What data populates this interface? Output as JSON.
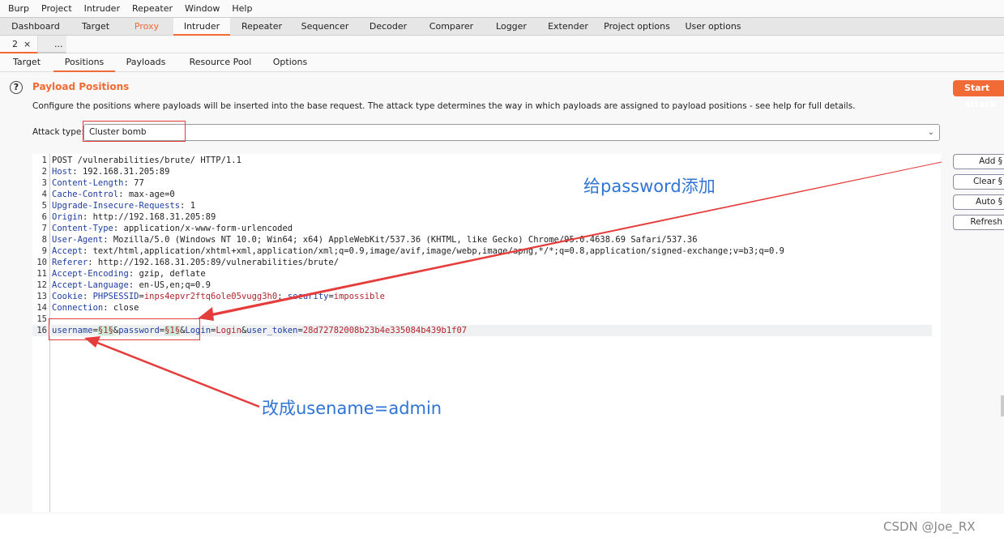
{
  "menu": [
    "Burp",
    "Project",
    "Intruder",
    "Repeater",
    "Window",
    "Help"
  ],
  "main_tabs": [
    "Dashboard",
    "Target",
    "Proxy",
    "Intruder",
    "Repeater",
    "Sequencer",
    "Decoder",
    "Comparer",
    "Logger",
    "Extender",
    "Project options",
    "User options"
  ],
  "intruder_tabs": {
    "tab": "2",
    "close": "×",
    "more": "..."
  },
  "sub_tabs": [
    "Target",
    "Positions",
    "Payloads",
    "Resource Pool",
    "Options"
  ],
  "positions": {
    "help": "?",
    "title": "Payload Positions",
    "description": "Configure the positions where payloads will be inserted into the base request. The attack type determines the way in which payloads are assigned to payload positions - see help for full details.",
    "attack_type_label": "Attack type:",
    "attack_type": "Cluster bomb",
    "start_attack": "Start attack",
    "buttons": [
      "Add §",
      "Clear §",
      "Auto §",
      "Refresh"
    ]
  },
  "request": [
    {
      "n": "1",
      "parts": [
        [
          "",
          "POST /vulnerabilities/brute/ HTTP/1.1"
        ]
      ]
    },
    {
      "n": "2",
      "parts": [
        [
          "hn",
          "Host"
        ],
        [
          "",
          ": 192.168.31.205:89"
        ]
      ]
    },
    {
      "n": "3",
      "parts": [
        [
          "hn",
          "Content-Length"
        ],
        [
          "",
          ": 77"
        ]
      ]
    },
    {
      "n": "4",
      "parts": [
        [
          "hn",
          "Cache-Control"
        ],
        [
          "",
          ": max-age=0"
        ]
      ]
    },
    {
      "n": "5",
      "parts": [
        [
          "hn",
          "Upgrade-Insecure-Requests"
        ],
        [
          "",
          ": 1"
        ]
      ]
    },
    {
      "n": "6",
      "parts": [
        [
          "hn",
          "Origin"
        ],
        [
          "",
          ": http://192.168.31.205:89"
        ]
      ]
    },
    {
      "n": "7",
      "parts": [
        [
          "hn",
          "Content-Type"
        ],
        [
          "",
          ": application/x-www-form-urlencoded"
        ]
      ]
    },
    {
      "n": "8",
      "parts": [
        [
          "hn",
          "User-Agent"
        ],
        [
          "",
          ": Mozilla/5.0 (Windows NT 10.0; Win64; x64) AppleWebKit/537.36 (KHTML, like Gecko) Chrome/95.0.4638.69 Safari/537.36"
        ]
      ]
    },
    {
      "n": "9",
      "parts": [
        [
          "hn",
          "Accept"
        ],
        [
          "",
          ": text/html,application/xhtml+xml,application/xml;q=0.9,image/avif,image/webp,image/apng,*/*;q=0.8,application/signed-exchange;v=b3;q=0.9"
        ]
      ]
    },
    {
      "n": "10",
      "parts": [
        [
          "hn",
          "Referer"
        ],
        [
          "",
          ": http://192.168.31.205:89/vulnerabilities/brute/"
        ]
      ]
    },
    {
      "n": "11",
      "parts": [
        [
          "hn",
          "Accept-Encoding"
        ],
        [
          "",
          ": gzip, deflate"
        ]
      ]
    },
    {
      "n": "12",
      "parts": [
        [
          "hn",
          "Accept-Language"
        ],
        [
          "",
          ": en-US,en;q=0.9"
        ]
      ]
    },
    {
      "n": "13",
      "parts": [
        [
          "hn",
          "Cookie"
        ],
        [
          "",
          ": "
        ],
        [
          "hn",
          "PHPSESSID"
        ],
        [
          "",
          "="
        ],
        [
          "pv",
          "inps4epvr2ftq6ole05vugg3h0"
        ],
        [
          "",
          "; "
        ],
        [
          "hn",
          "security"
        ],
        [
          "",
          "="
        ],
        [
          "pv",
          "impossible"
        ]
      ]
    },
    {
      "n": "14",
      "parts": [
        [
          "hn",
          "Connection"
        ],
        [
          "",
          ": close"
        ]
      ]
    },
    {
      "n": "15",
      "parts": []
    },
    {
      "n": "16",
      "parts": [
        [
          "hn",
          "username"
        ],
        [
          "",
          "="
        ],
        [
          "mk",
          "§1§"
        ],
        [
          "",
          "&"
        ],
        [
          "hn",
          "password"
        ],
        [
          "",
          "="
        ],
        [
          "mk",
          "§1§"
        ],
        [
          "",
          "&"
        ],
        [
          "hn",
          "Login"
        ],
        [
          "",
          "="
        ],
        [
          "pv",
          "Login"
        ],
        [
          "",
          "&"
        ],
        [
          "hn",
          "user_token"
        ],
        [
          "",
          "="
        ],
        [
          "pv",
          "28d72782008b23b4e335084b439b1f07"
        ]
      ]
    }
  ],
  "annotations": {
    "add_password": "给password添加",
    "change_username": "改成usename=admin"
  },
  "watermark": "CSDN @Joe_RX",
  "colors": {
    "accent": "#f26a35",
    "annotation": "#2f74d6",
    "arrow": "#e53c3c"
  }
}
